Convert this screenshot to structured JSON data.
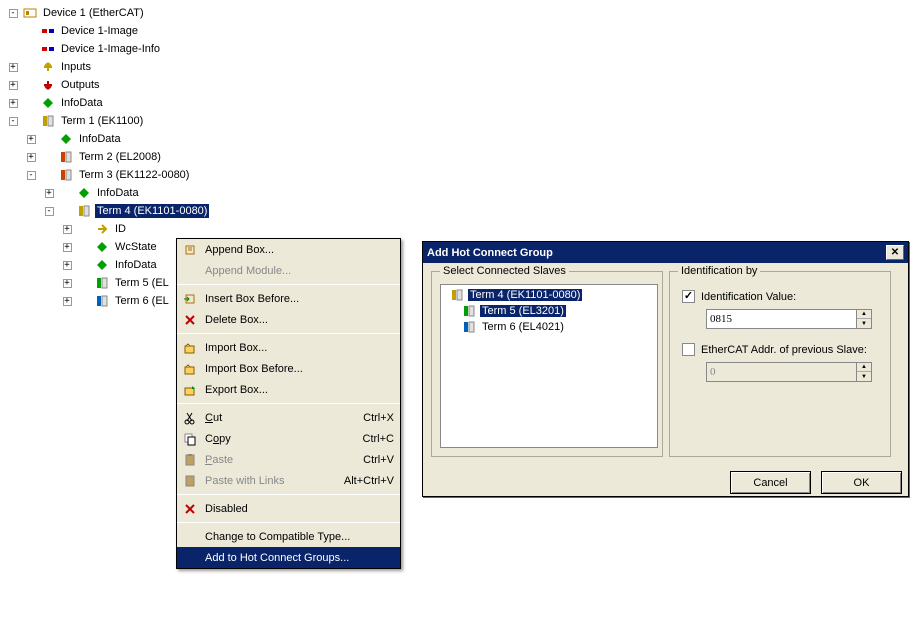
{
  "tree": {
    "device": "Device 1 (EtherCAT)",
    "image": "Device 1-Image",
    "imageInfo": "Device 1-Image-Info",
    "inputs": "Inputs",
    "outputs": "Outputs",
    "infoData": "InfoData",
    "term1": "Term 1 (EK1100)",
    "t1info": "InfoData",
    "term2": "Term 2 (EL2008)",
    "term3": "Term 3 (EK1122-0080)",
    "t3info": "InfoData",
    "term4": "Term 4 (EK1101-0080)",
    "t4id": "ID",
    "t4wc": "WcState",
    "t4info": "InfoData",
    "term5": "Term 5 (EL",
    "term6": "Term 6 (EL"
  },
  "menu": {
    "appendBox": "Append Box...",
    "appendModule": "Append Module...",
    "insert": "Insert Box Before...",
    "deleteBox": "Delete Box...",
    "importBox": "Import Box...",
    "importBefore": "Import Box Before...",
    "exportBox": "Export Box...",
    "cut": "Cut",
    "copy": "Copy",
    "paste": "Paste",
    "pasteLinks": "Paste with Links",
    "disabled": "Disabled",
    "change": "Change to Compatible Type...",
    "addHot": "Add to Hot Connect Groups...",
    "shortcuts": {
      "cut": "Ctrl+X",
      "copy": "Ctrl+C",
      "paste": "Ctrl+V",
      "pasteLinks": "Alt+Ctrl+V"
    }
  },
  "dialog": {
    "title": "Add Hot Connect Group",
    "selectSlaves": "Select Connected Slaves",
    "identBy": "Identification by",
    "identVal": "Identification Value:",
    "identInput": "0815",
    "addrPrev": "EtherCAT Addr. of previous Slave:",
    "addrInput": "0",
    "cancel": "Cancel",
    "ok": "OK",
    "slaves": {
      "s1": "Term 4 (EK1101-0080)",
      "s2": "Term 5 (EL3201)",
      "s3": "Term 6 (EL4021)"
    }
  },
  "icons": {
    "device": "#d08000",
    "red": "#d00000",
    "blue": "#0000d0",
    "inputs": "#c0a000",
    "outputs": "#c00000",
    "diamond": "#00a000",
    "term": "#c0a000",
    "termRed": "#d04000",
    "termBlue": "#0060c0",
    "termGreen": "#00a000",
    "menuBox": "#d08000",
    "menuIns": "#008000",
    "menuDel": "#c00000",
    "menuImp": "#806000",
    "menuCut": "#000",
    "menuCopy": "#000",
    "menuDis": "#c00000"
  }
}
